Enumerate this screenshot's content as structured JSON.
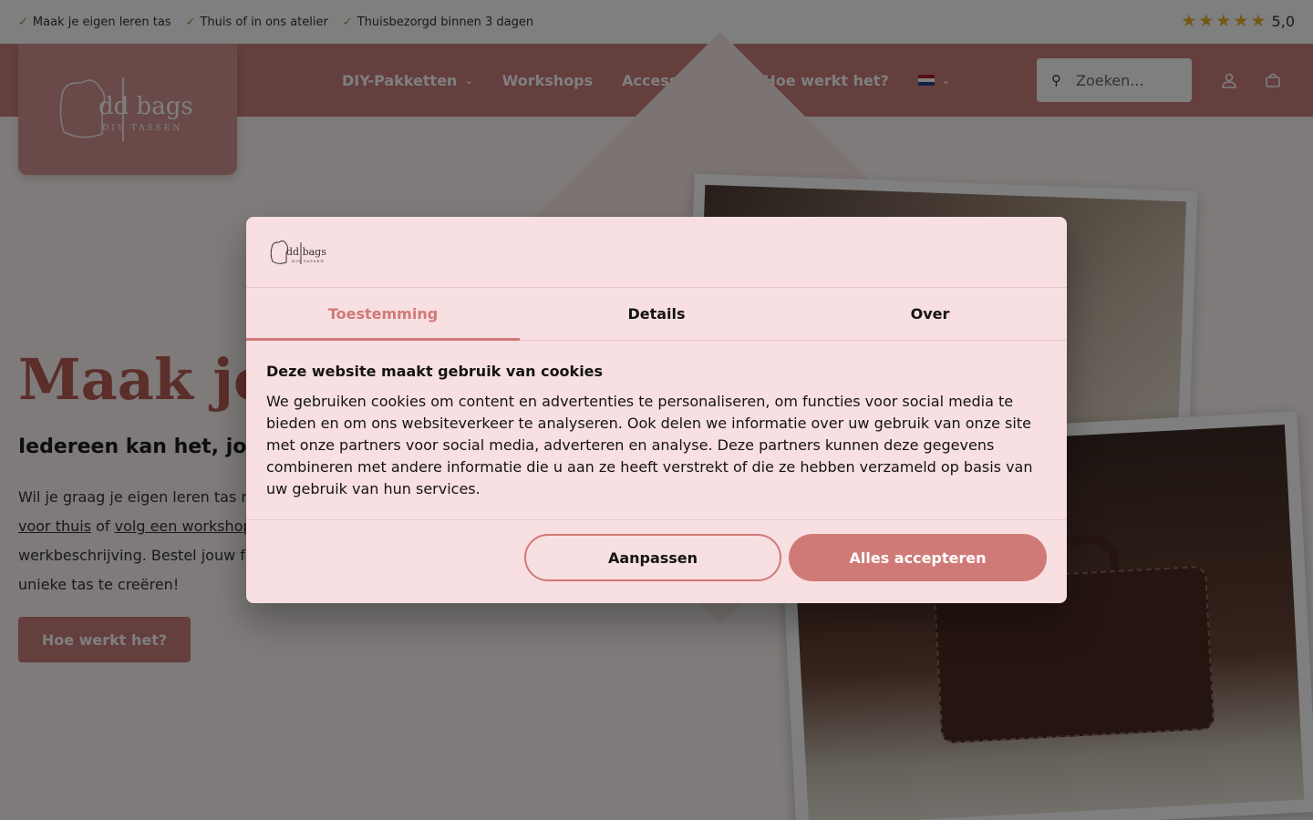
{
  "topbar": {
    "usps": [
      "Maak je eigen leren tas",
      "Thuis of in ons atelier",
      "Thuisbezorgd binnen 3 dagen"
    ],
    "rating": {
      "score_label": "5,0",
      "stars": 5
    }
  },
  "header": {
    "logo_text": "dd bags",
    "logo_sub": "DIY TASSEN",
    "nav": [
      {
        "label": "DIY-Pakketten",
        "has_dropdown": true
      },
      {
        "label": "Workshops",
        "has_dropdown": false
      },
      {
        "label": "Accessoires",
        "has_dropdown": true
      },
      {
        "label": "Hoe werkt het?",
        "has_dropdown": false
      }
    ],
    "language": "nl",
    "search_placeholder": "Zoeken..."
  },
  "hero": {
    "title": "Maak je e",
    "subtitle": "Iedereen kan het, jon",
    "text_part1": "Wil je graag je eigen leren tas ma",
    "link1": "voor thuis",
    "text_part2": " of ",
    "link2": "volg een workshop",
    "text_part3": "werkbeschrijving. Bestel jouw fav",
    "text_part4": "unieke tas te creëren!",
    "button_label": "Hoe werkt het?"
  },
  "cookie_dialog": {
    "logo_text": "dd bags",
    "logo_sub": "DIY TASSEN",
    "tabs": [
      {
        "label": "Toestemming",
        "active": true
      },
      {
        "label": "Details",
        "active": false
      },
      {
        "label": "Over",
        "active": false
      }
    ],
    "title": "Deze website maakt gebruik van cookies",
    "body": "We gebruiken cookies om content en advertenties te personaliseren, om functies voor social media te bieden en om ons websiteverkeer te analyseren. Ook delen we informatie over uw gebruik van onze site met onze partners voor social media, adverteren en analyse. Deze partners kunnen deze gegevens combineren met andere informatie die u aan ze heeft verstrekt of die ze hebben verzameld op basis van uw gebruik van hun services.",
    "customize_label": "Aanpassen",
    "accept_label": "Alles accepteren"
  },
  "colors": {
    "brand": "#c97f7a",
    "accent": "#d07a77",
    "dialog_bg": "#f8dfe1"
  }
}
